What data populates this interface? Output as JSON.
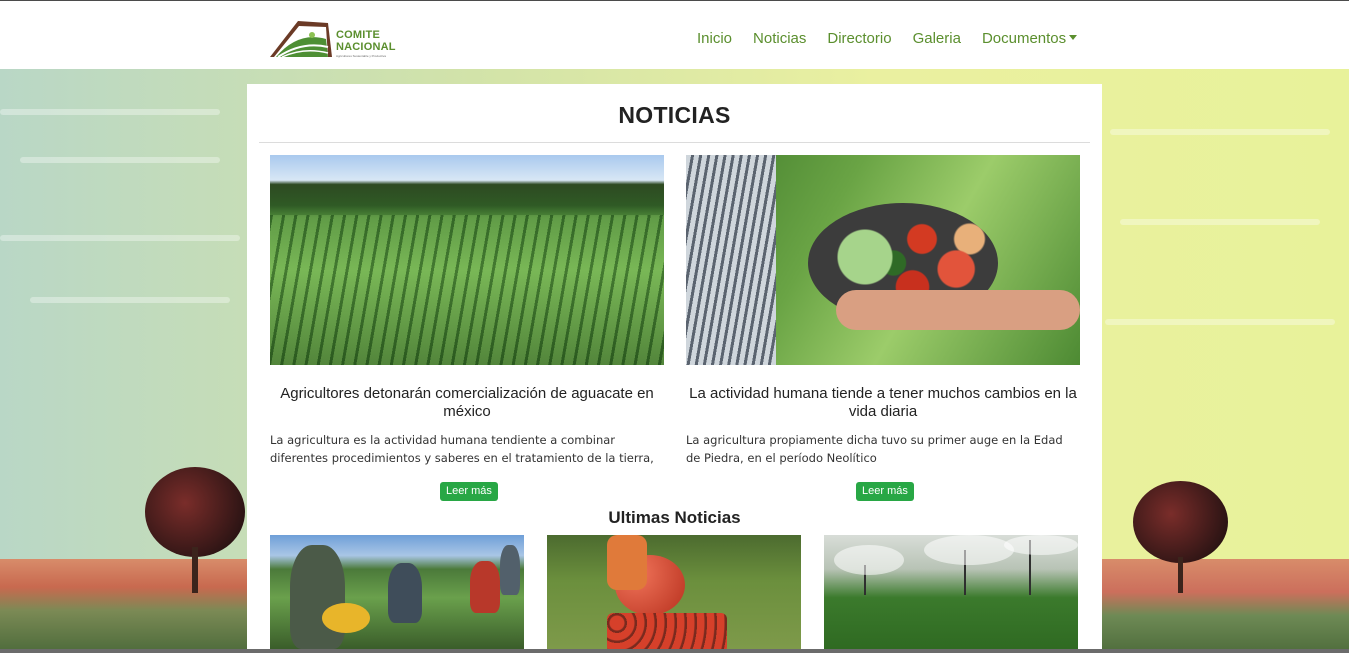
{
  "brand": {
    "logo_line1": "COMITE",
    "logo_line2": "NACIONAL",
    "logo_tagline": "Agricultores Sustentable y Productiva"
  },
  "nav": {
    "items": [
      {
        "label": "Inicio"
      },
      {
        "label": "Noticias"
      },
      {
        "label": "Directorio"
      },
      {
        "label": "Galeria"
      },
      {
        "label": "Documentos",
        "has_dropdown": true
      }
    ]
  },
  "page": {
    "title": "NOTICIAS"
  },
  "featured": [
    {
      "image": "corn-field-image",
      "headline": "Agricultores detonarán comercialización de aguacate en méxico",
      "description": "La agricultura es la actividad humana tendiente a combinar diferentes procedimientos y saberes en el tratamiento de la tierra,",
      "button_label": "Leer más"
    },
    {
      "image": "vegetable-bowl-image",
      "headline": "La actividad humana tiende a tener muchos cambios en la vida diaria",
      "description": "La agricultura propiamente dicha tuvo su primer auge en la Edad de Piedra, en el período Neolítico",
      "button_label": "Leer más"
    }
  ],
  "latest": {
    "title": "Ultimas Noticias",
    "items": [
      {
        "image": "farm-workers-image"
      },
      {
        "image": "tomato-harvest-image"
      },
      {
        "image": "sprinkler-field-image"
      }
    ]
  },
  "colors": {
    "brand_green": "#5b8f2e",
    "button_green": "#28a745",
    "text_dark": "#222222"
  }
}
